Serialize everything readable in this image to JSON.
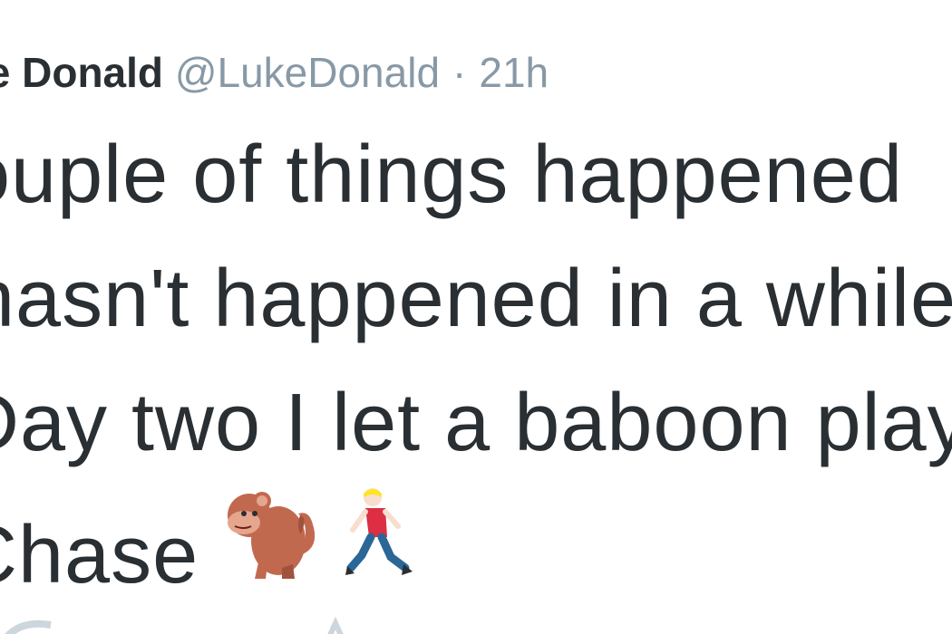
{
  "tweet": {
    "display_name": "Luke Donald",
    "handle": "@LukeDonald",
    "separator": "·",
    "time": "21h",
    "lines": [
      "Couple of things happened",
      "hasn't happened in a while",
      "Day two I let a baboon play",
      "Chase"
    ],
    "emojis": [
      "monkey-icon",
      "runner-icon"
    ]
  },
  "colors": {
    "text": "#292f33",
    "muted": "#8899a6",
    "background": "#ffffff"
  }
}
